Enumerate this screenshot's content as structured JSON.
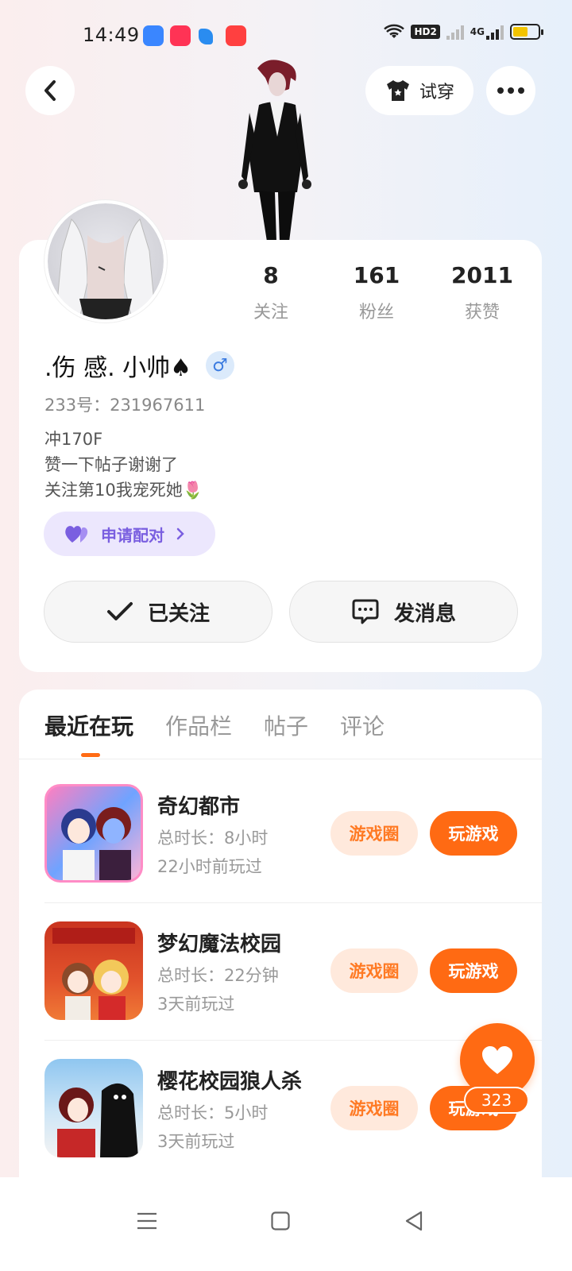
{
  "status_bar": {
    "time": "14:49",
    "network_type": "4G",
    "hd_label": "HD2",
    "notification_icons": [
      "message-app-icon",
      "video-app-icon",
      "feather-app-icon",
      "shopping-app-icon"
    ],
    "notification_colors": [
      "#3a86ff",
      "#ff3355",
      "#2a8cf0",
      "#ff4040"
    ],
    "battery_level_percent": 60
  },
  "header": {
    "try_on_label": "试穿"
  },
  "profile": {
    "stats": [
      {
        "value": "8",
        "label": "关注"
      },
      {
        "value": "161",
        "label": "粉丝"
      },
      {
        "value": "2011",
        "label": "获赞"
      }
    ],
    "name": ".伤 感. 小帅♠",
    "gender_symbol": "♂",
    "uid": "233号：231967611",
    "bio": [
      "冲170F",
      "赞一下帖子谢谢了",
      "关注第10我宠死她🌷"
    ],
    "pair_label": "申请配对",
    "follow_label": "已关注",
    "message_label": "发消息"
  },
  "tabs": [
    "最近在玩",
    "作品栏",
    "帖子",
    "评论"
  ],
  "games": [
    {
      "title": "奇幻都市",
      "duration": "总时长：8小时",
      "last_played": "22小时前玩过",
      "circle_label": "游戏圈",
      "play_label": "玩游戏"
    },
    {
      "title": "梦幻魔法校园",
      "duration": "总时长：22分钟",
      "last_played": "3天前玩过",
      "circle_label": "游戏圈",
      "play_label": "玩游戏"
    },
    {
      "title": "樱花校园狼人杀",
      "duration": "总时长：5小时",
      "last_played": "3天前玩过",
      "circle_label": "游戏圈",
      "play_label": "玩游戏"
    }
  ],
  "like": {
    "count": "323"
  },
  "colors": {
    "accent": "#ff6a13",
    "pair_purple": "#7a5fe0"
  }
}
